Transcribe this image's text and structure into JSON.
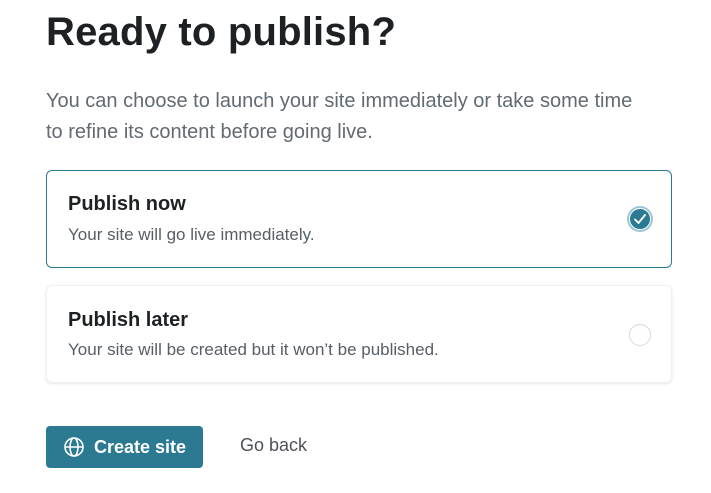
{
  "page": {
    "title": "Ready to publish?",
    "description": "You can choose to launch your site immediately or take some time to refine its content before going live."
  },
  "options": [
    {
      "title": "Publish now",
      "subtitle": "Your site will go live immediately.",
      "selected": true
    },
    {
      "title": "Publish later",
      "subtitle": "Your site will be created but it won’t be published.",
      "selected": false
    }
  ],
  "actions": {
    "primary_label": "Create site",
    "primary_icon": "globe-icon",
    "secondary_label": "Go back"
  },
  "colors": {
    "accent": "#2b7a92",
    "text": "#1e2124",
    "muted": "#626a72"
  }
}
